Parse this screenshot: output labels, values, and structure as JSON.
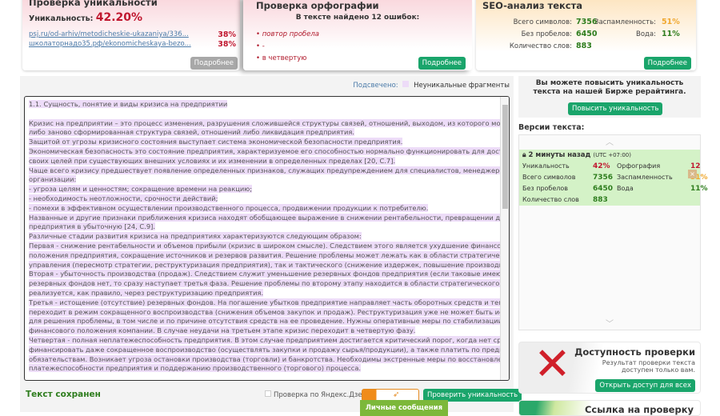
{
  "uniqueness": {
    "title": "Проверка уникальности",
    "label": "Уникальность:",
    "value": "42.20%",
    "sources": [
      {
        "url": "psj.ru/od-arhiv/metodicheskie-ukazaniya/336...",
        "pct": "38%"
      },
      {
        "url": "школаторнадо35.рф/ekonomicheskaya-bezo...",
        "pct": "38%"
      }
    ],
    "more": "Подробнее"
  },
  "spelling": {
    "title": "Проверка орфографии",
    "summary": "В тексте найдено 12 ошибок:",
    "errors": [
      "повтор пробела",
      "-",
      "в четвертую"
    ],
    "more": "Подробнее"
  },
  "seo": {
    "title": "SEO-анализ текста",
    "chars_label": "Всего символов:",
    "chars": "7356",
    "nospace_label": "Без пробелов:",
    "nospace": "6450",
    "words_label": "Количество слов:",
    "words": "883",
    "spam_label": "Заспамленность:",
    "spam": "51%",
    "water_label": "Вода:",
    "water": "11%",
    "more": "Подробнее"
  },
  "legend": {
    "label": "Подсвечено:",
    "item": "Неуникальные фрагменты"
  },
  "text_lines": [
    "1.1. Сущность, понятие и виды кризиса на предприятии",
    "",
    "Кризис на предприятии – это процесс изменения, разрушения сложившейся структуры связей, отношений, выходом, из которого может стать",
    "либо заново сформированная структура связей, отношений либо ликвидация предприятия.",
    "Защитой от угрозы кризисного состояния выступает система экономической безопасности предприятия.",
    "Экономическая безопасность  это состояние предприятия, характеризуемое его способностью нормально функционировать для достижения",
    "своих целей при существующих внешних условиях и их изменении в определенных пределах [20, С.7].",
    "Чаще всего кризису предшествует появление определенных признаков, служащих предупреждением для специалистов, менеджеров",
    "организации:",
    "- угроза целям и ценностям; сокращение времени на реакцию;",
    "- необходимость неотложности, срочности действий;",
    "- помехи в эффективном осуществлении производственного процесса, продвижении продукции к потребителю.",
    "Названные и другие признаки приближения кризиса находят обобщающее выражение в снижении рентабельности, превращении деятельности",
    "предприятия в убыточную [24, С.9].",
    "Различные стадии развития кризиса на предприятиях характеризуются следующим образом:",
    "Первая - снижение рентабельности и объемов прибыли (кризис в широком смысле). Следствием этого является ухудшение финансового",
    "положения предприятия, сокращение источников и резервов развития. Решение проблемы может лежать как в области стратегического",
    "управления (пересмотр стратегии, реструктуризация предприятия), так и тактического (снижение издержек, повышение производительности).",
    "Вторая - убыточность производства (продаж). Следствием служит уменьшение резервных фондов предприятия (если таковые имеются). Если",
    "резервных фондов нет, то сразу наступает третья фаза. Решение проблемы по второму этапу находится в области стратегического управления и",
    "реализуется, как правило, через реструктуризацию предприятия.",
    "Третья - истощение (отсутствие) резервных фондов. На погашение убытков предприятие направляет часть оборотных средств и тем самым",
    "переходит в режим сокращенного воспроизводства (снижения объемов закупок и продаж). Реструктуризация уже не может быть использована",
    "для решения проблемы, в том числе и по причине отсутствия средств на ее проведение. Нужны оперативные меры по стабилизации",
    "финансового положения компании. В случае неудачи на третьем этапе кризис переходит в четвертую фазу.",
    "Четвертая - полная неплатежеспособность предприятия. В этом случае предприятием достигается критический порог, когда нет средств",
    "финансировать даже сокращенное воспроизводство (осуществлять закупки и продажу сырья/продукции), а также платить по предыдущим",
    "обязательствам. Возникает угроза остановки производства (торговли) и банкротства. Необходимы экстренные меры по восстановлению",
    "платежеспособности предприятия и поддержанию производственного (торгового) процесса."
  ],
  "footer": {
    "saved": "Текст сохранен",
    "dzen": "Проверка по Яндекс.Дзен",
    "check": "Проверить уникальность",
    "messages": "Личные сообщения"
  },
  "promo": {
    "text": "Вы можете повысить уникальность текста на нашей Бирже рерайтинга.",
    "button": "Повысить уникальность"
  },
  "versions": {
    "title": "Версии текста:",
    "time": "2 минуты назад",
    "tz": "(UTC +07:00)",
    "rows": [
      [
        "Уникальность",
        "42%",
        "Орфография",
        "12"
      ],
      [
        "Всего символов",
        "7356",
        "Заспамленность",
        "51%"
      ],
      [
        "Без пробелов",
        "6450",
        "Вода",
        "11%"
      ],
      [
        "Количество слов",
        "883",
        "",
        ""
      ]
    ]
  },
  "access": {
    "title": "Доступность проверки",
    "text": "Результат проверки текста доступен только вам.",
    "button": "Открыть доступ для всех"
  },
  "link": {
    "title": "Ссылка на проверку"
  }
}
